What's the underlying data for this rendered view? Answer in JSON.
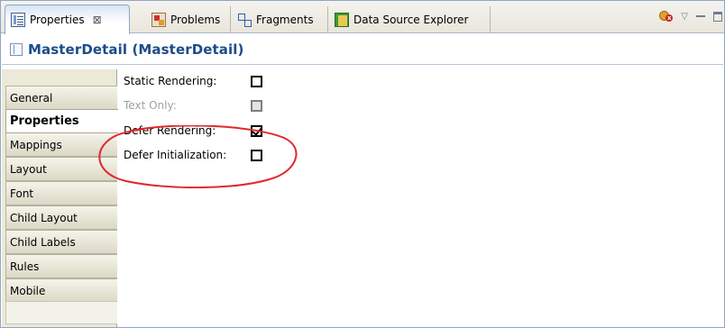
{
  "tabs": [
    {
      "label": "Properties",
      "icon": "properties-icon",
      "active": true,
      "close": "⊠"
    },
    {
      "label": "Problems",
      "icon": "problems-icon",
      "active": false
    },
    {
      "label": "Fragments",
      "icon": "fragments-icon",
      "active": false
    },
    {
      "label": "Data Source Explorer",
      "icon": "data-source-explorer-icon",
      "active": false
    }
  ],
  "view_toolbar": {
    "pin_icon": "pin-error-icon",
    "menu_glyph": "▽",
    "minimize_icon": "minimize-icon",
    "maximize_icon": "maximize-icon"
  },
  "header": {
    "icon": "component-icon",
    "title": "MasterDetail (MasterDetail)"
  },
  "categories": [
    {
      "label": "General",
      "active": false
    },
    {
      "label": "Properties",
      "active": true
    },
    {
      "label": "Mappings",
      "active": false
    },
    {
      "label": "Layout",
      "active": false
    },
    {
      "label": "Font",
      "active": false
    },
    {
      "label": "Child Layout",
      "active": false
    },
    {
      "label": "Child Labels",
      "active": false
    },
    {
      "label": "Rules",
      "active": false
    },
    {
      "label": "Mobile",
      "active": false
    }
  ],
  "properties": [
    {
      "label": "Static Rendering:",
      "checked": false,
      "enabled": true
    },
    {
      "label": "Text Only:",
      "checked": false,
      "enabled": false
    },
    {
      "label": "Defer Rendering:",
      "checked": true,
      "enabled": true
    },
    {
      "label": "Defer Initialization:",
      "checked": false,
      "enabled": true
    }
  ],
  "colors": {
    "title_blue": "#1d4b8a",
    "annotation_red": "#e0282e",
    "panel_beige": "#ece9d8"
  }
}
